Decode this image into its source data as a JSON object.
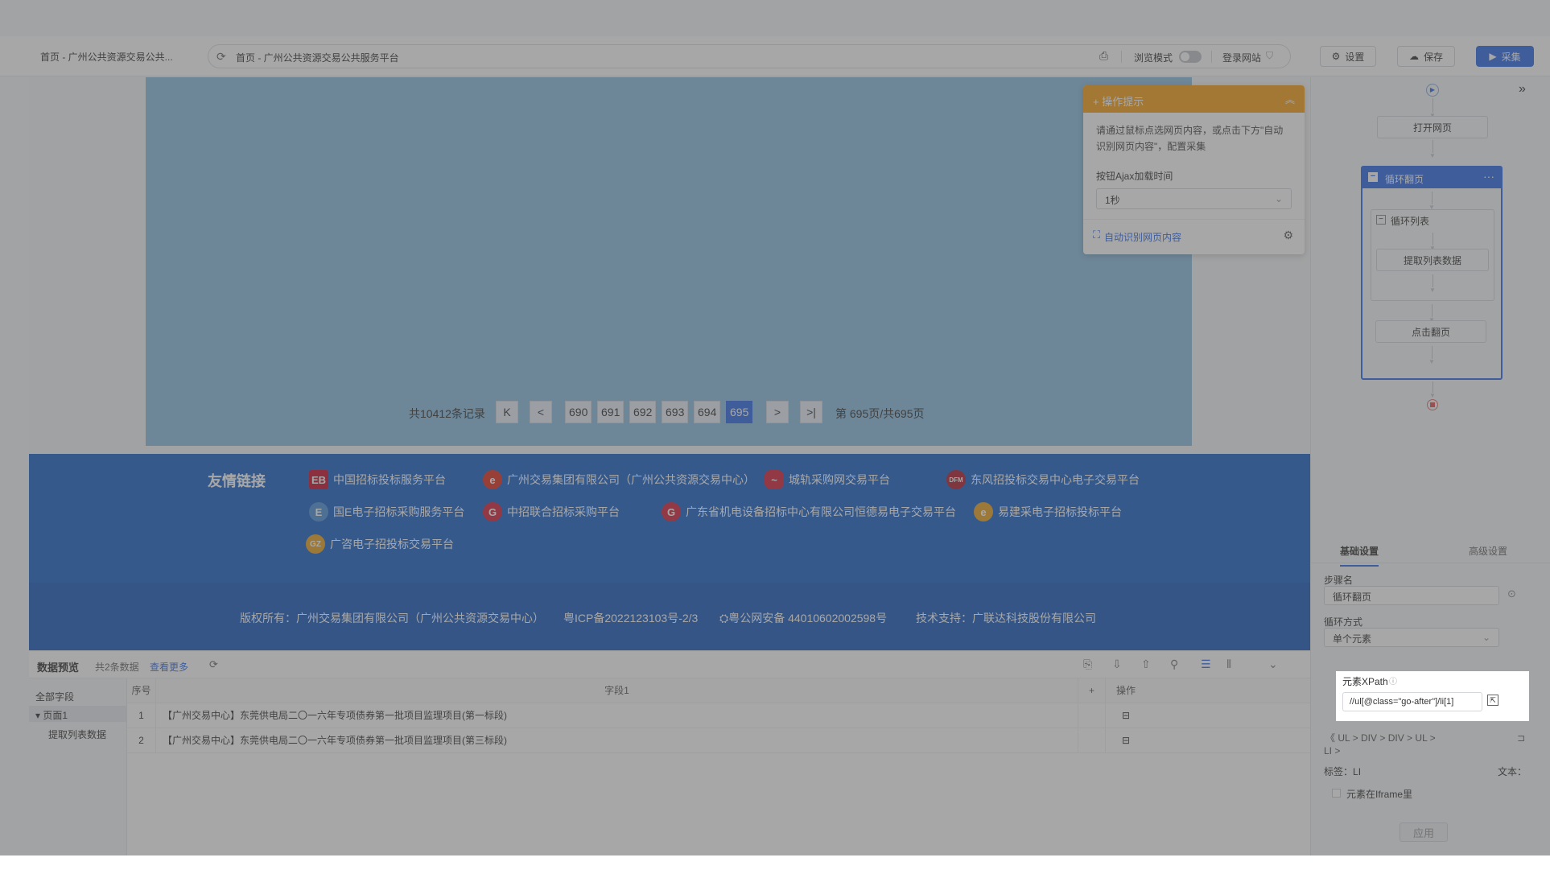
{
  "browser": {
    "tab_title": "首页 - 广州公共资源交易公共...",
    "url": "首页 - 广州公共资源交易公共服务平台",
    "browse_mode_label": "浏览模式",
    "login_site_label": "登录网站"
  },
  "toolbar": {
    "settings_label": "设置",
    "save_label": "保存",
    "collect_label": "采集"
  },
  "pager": {
    "total": "共10412条记录",
    "first": "K",
    "prev": "<",
    "pages": [
      "690",
      "691",
      "692",
      "693",
      "694",
      "695"
    ],
    "active_page": "695",
    "next": ">",
    "last": ">|",
    "summary": "第 695页/共695页"
  },
  "friend_links": {
    "title": "友情链接",
    "items": [
      "中国招标投标服务平台",
      "广州交易集团有限公司（广州公共资源交易中心）",
      "城轨采购网交易平台",
      "东风招投标交易中心电子交易平台",
      "国E电子招标采购服务平台",
      "中招联合招标采购平台",
      "广东省机电设备招标中心有限公司恒德易电子交易平台",
      "易建采电子招标投标平台",
      "广咨电子招投标交易平台"
    ],
    "logos": [
      "EB",
      "e",
      "~",
      "DFM",
      "E",
      "G",
      "G",
      "e",
      "GZ"
    ]
  },
  "copyright": {
    "owner": "版权所有：广州交易集团有限公司（广州公共资源交易中心）",
    "icp": "粤ICP备2022123103号-2/3",
    "police": "粤公网安备 44010602002598号",
    "support": "技术支持：广联达科技股份有限公司"
  },
  "tips": {
    "title": "操作提示",
    "body": "请通过鼠标点选网页内容，或点击下方\"自动识别网页内容\"，配置采集",
    "ajax_label": "按钮Ajax加载时间",
    "ajax_value": "1秒",
    "auto_detect": "自动识别网页内容"
  },
  "preview": {
    "title": "数据预览",
    "count": "共2条数据",
    "more": "查看更多",
    "tree": {
      "all_fields": "全部字段",
      "page1": "页面1",
      "extract": "提取列表数据"
    },
    "columns": [
      "序号",
      "字段1",
      "+",
      "操作"
    ],
    "rows": [
      [
        "1",
        "【广州交易中心】东莞供电局二〇一六年专项债券第一批项目监理项目(第一标段)"
      ],
      [
        "2",
        "【广州交易中心】东莞供电局二〇一六年专项债券第一批项目监理项目(第三标段)"
      ]
    ]
  },
  "flow": {
    "open_page": "打开网页",
    "loop_page": "循环翻页",
    "loop_list": "循环列表",
    "extract_list": "提取列表数据",
    "click_page": "点击翻页"
  },
  "settings": {
    "tab_basic": "基础设置",
    "tab_advanced": "高级设置",
    "step_name_label": "步骤名",
    "step_name_value": "循环翻页",
    "loop_mode_label": "循环方式",
    "loop_mode_value": "单个元素",
    "xpath_label": "元素XPath",
    "xpath_value": "//ul[@class=\"go-after\"]/li[1]",
    "crumbs": [
      "《",
      "UL",
      ">",
      "DIV",
      ">",
      "DIV",
      ">",
      "UL",
      ">",
      "LI",
      ">"
    ],
    "tag_label": "标签：",
    "tag_value": "LI",
    "text_label": "文本：",
    "iframe_label": "元素在Iframe里",
    "apply_label": "应用"
  }
}
